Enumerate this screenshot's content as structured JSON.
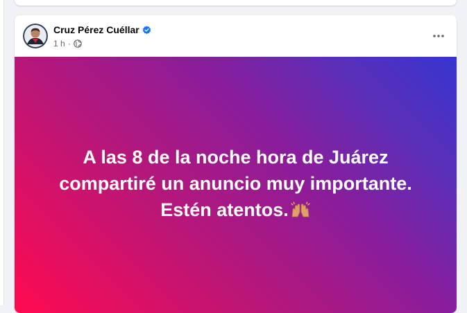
{
  "post": {
    "author": "Cruz Pérez Cuéllar",
    "time": "1 h",
    "separator": "·",
    "body_lines": [
      "A las 8 de la noche hora de Juárez",
      "compartiré un anuncio muy importante.",
      "Estén atentos."
    ],
    "emoji": "🙌🏽"
  },
  "colors": {
    "gradient_start": "#ff0a4f",
    "gradient_end": "#3635d0",
    "verified": "#1877f2",
    "meta_text": "#65676b"
  },
  "icons": {
    "verified": "verified-badge-icon",
    "audience": "globe-icon",
    "more": "more-options-icon",
    "emoji": "raising-hands-icon"
  }
}
